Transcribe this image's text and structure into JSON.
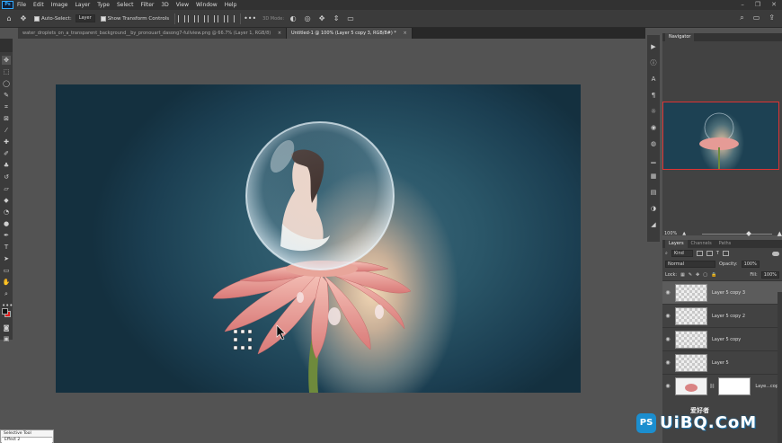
{
  "menubar": {
    "logo": "Ps",
    "items": [
      "File",
      "Edit",
      "Image",
      "Layer",
      "Type",
      "Select",
      "Filter",
      "3D",
      "View",
      "Window",
      "Help"
    ]
  },
  "options": {
    "auto_select_label": "Auto-Select:",
    "auto_select_value": "Layer",
    "transform_label": "Show Transform Controls",
    "mode_3d": "3D Mode:"
  },
  "tabs": [
    {
      "label": "water_droplets_on_a_transparent_background__by_pronouart_dasong7-fullview.png @ 66.7% (Layer 1, RGB/8)",
      "close": "×"
    },
    {
      "label": "Untitled-1 @ 100% (Layer 5 copy 3, RGB/8#) *",
      "close": "×"
    }
  ],
  "navigator": {
    "tab_label": "Navigator",
    "zoom": "100%"
  },
  "layers_panel": {
    "tabs": [
      "Layers",
      "Channels",
      "Paths"
    ],
    "filter_kind": "Kind",
    "blend_mode": "Normal",
    "opacity_label": "Opacity:",
    "opacity_value": "100%",
    "lock_label": "Lock:",
    "fill_label": "Fill:",
    "fill_value": "100%",
    "layers": [
      {
        "name": "Layer 5 copy 3"
      },
      {
        "name": "Layer 5 copy 2"
      },
      {
        "name": "Layer 5 copy"
      },
      {
        "name": "Layer 5"
      },
      {
        "name": "Laye...copy"
      }
    ]
  },
  "bottom_panel": {
    "title": "Selective Tool",
    "field": "Effect 2"
  },
  "watermark": {
    "badge": "PS",
    "main": "UiBQ.CoM",
    "sub": "爱好者"
  },
  "colors": {
    "accent": "#31a8ff",
    "foreground": "#111111",
    "background": "#e21b1b",
    "nav_frame": "#dd3333"
  }
}
